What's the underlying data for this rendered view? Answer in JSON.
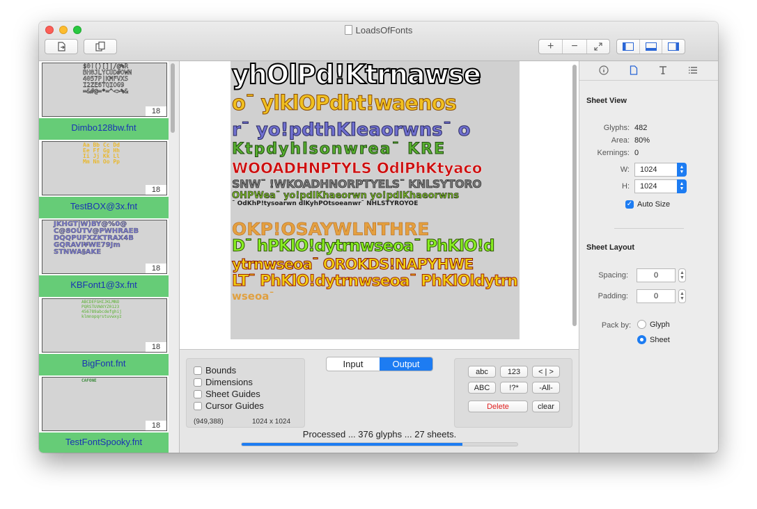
{
  "window": {
    "title": "LoadsOfFonts"
  },
  "sidebar": {
    "items": [
      {
        "label": "Dimbo128bw.fnt",
        "count": "18",
        "preview": "$0!()[]|/@%R\nBH8JLYCUD#OWN\n4057P|KMFVXS\nI2ZE6TQIOG9\n=&#@=*=^<>%&"
      },
      {
        "label": "TestBOX@3x.fnt",
        "count": "18",
        "preview": "Aa Bb Cc Dd\nEe Ff Gg Hh\nIi Jj Kk Ll\nMm Nn Oo Pp"
      },
      {
        "label": "KBFont1@3x.fnt",
        "count": "18",
        "preview": "JKHGT|W)BY@%0@\nC@8OUTV@PWHRAEB\nDQQPUFXZKTRAX4B\nGQRAVI¥WE79Jm\nSTNWA§AKE"
      },
      {
        "label": "BigFont.fnt",
        "count": "18",
        "preview": "ABCDEFGHIJKLMNO\nPQRSTUVWXYZ0123\n456789abcdefghij\nklmnopqrstuvwxyz"
      },
      {
        "label": "TestFontSpooky.fnt",
        "count": "18",
        "preview": "CAFONE"
      }
    ]
  },
  "sheet_rows": [
    "yhOlPd!Ktrnawse",
    "o¯ ylklOPdht!waenos",
    "r¯ yo!pdthKleaorwns¯ o",
    "Ktpdyhlsonwrea¯ KRE",
    "WOOADHNPTYLS OdlPhKtyaco",
    "SNW¯ !WKOADHNORPTYELS¯ KNLSYTORO",
    "OHPWea¯ yo!pdlKhaeorwn yo!pdlKhaeorwns",
    "¯ OdKhP!tysoarwn dlKyhPOtsoeanwr¯ NHLSTYROYOE",
    "OKP!OSAYWLNTHRE",
    "D¯ hPKlO!dytrnwseoa¯ PhKlO!d",
    "ytrnwseoa¯ OROKDS!NAPYHWE",
    "LT¯ PhKlO!dytrnwseoa¯ PhKlOldytrn",
    "wseoa¯"
  ],
  "bottom": {
    "checkboxes": [
      {
        "label": "Bounds",
        "checked": false
      },
      {
        "label": "Dimensions",
        "checked": false
      },
      {
        "label": "Sheet Guides",
        "checked": false
      },
      {
        "label": "Cursor Guides",
        "checked": false
      }
    ],
    "cursor_pos": "(949,388)",
    "sheet_size": "1024 x 1024",
    "segment": {
      "input": "Input",
      "output": "Output",
      "selected": "Output"
    },
    "keys": {
      "abc": "abc",
      "num": "123",
      "brackets": "< | >",
      "upper": "ABC",
      "symbols": "!?*",
      "all": "-All-",
      "delete": "Delete",
      "clear": "clear"
    },
    "status": "Processed ... 376 glyphs ... 27 sheets.",
    "progress": 0.8
  },
  "inspector": {
    "sheet_view": {
      "title": "Sheet View",
      "glyphs_label": "Glyphs:",
      "glyphs": "482",
      "area_label": "Area:",
      "area": "80%",
      "kernings_label": "Kernings:",
      "kernings": "0",
      "w_label": "W:",
      "w": "1024",
      "h_label": "H:",
      "h": "1024",
      "autosize_label": "Auto Size"
    },
    "sheet_layout": {
      "title": "Sheet Layout",
      "spacing_label": "Spacing:",
      "spacing": "0",
      "padding_label": "Padding:",
      "padding": "0",
      "packby_label": "Pack by:",
      "glyph_label": "Glyph",
      "sheet_label": "Sheet",
      "selected": "Sheet"
    }
  },
  "colors": {
    "accent": "#1d7cf2",
    "sidebar_label_bg": "#66cc77",
    "sidebar_label_text": "#1a33b3",
    "delete_text": "#e02020"
  }
}
